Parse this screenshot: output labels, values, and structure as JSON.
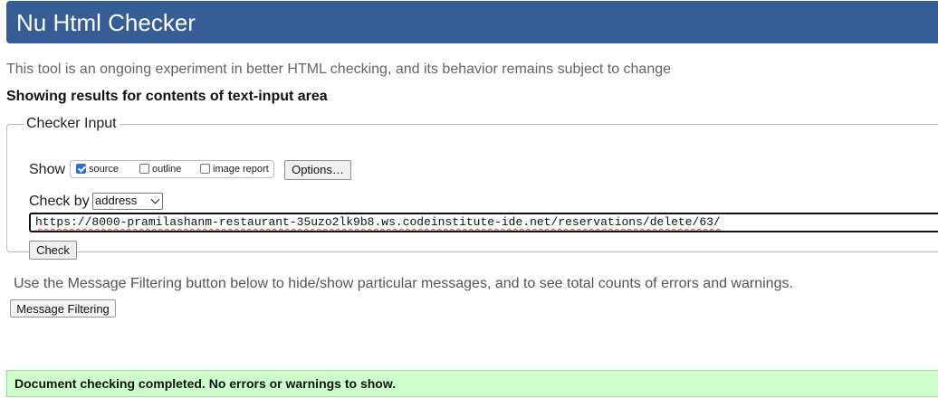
{
  "header": {
    "title": "Nu Html Checker"
  },
  "intro": {
    "subtitle": "This tool is an ongoing experiment in better HTML checking, and its behavior remains subject to change",
    "results_heading": "Showing results for contents of text-input area"
  },
  "checker_input": {
    "legend": "Checker Input",
    "show_label": "Show",
    "show_options": [
      {
        "label": "source",
        "checked": true
      },
      {
        "label": "outline",
        "checked": false
      },
      {
        "label": "image report",
        "checked": false
      }
    ],
    "options_button": "Options…",
    "check_by_label": "Check by",
    "check_by_selected": "address",
    "url_value": "https://8000-pramilashanm-restaurant-35uzo2lk9b8.ws.codeinstitute-ide.net/reservations/delete/63/",
    "check_button": "Check"
  },
  "filtering": {
    "description": "Use the Message Filtering button below to hide/show particular messages, and to see total counts of errors and warnings.",
    "button": "Message Filtering"
  },
  "result": {
    "message": "Document checking completed. No errors or warnings to show."
  },
  "colors": {
    "header_bg": "#365d95",
    "success_bg": "#ccffcc"
  }
}
